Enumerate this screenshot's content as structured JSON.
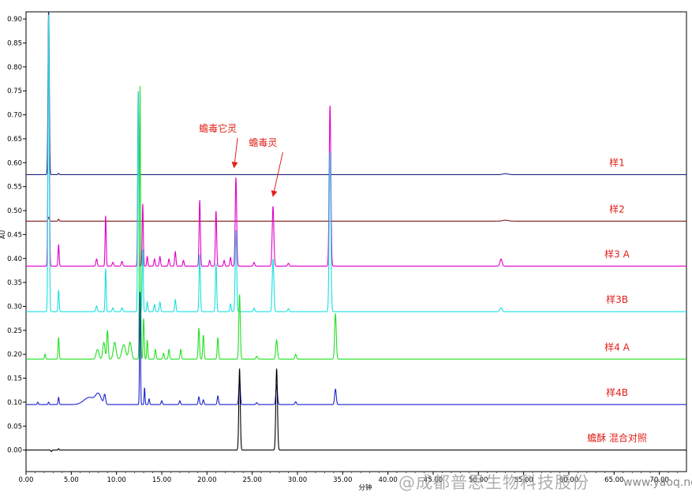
{
  "chart_data": {
    "type": "line",
    "title": "",
    "xlabel": "分钟",
    "ylabel": "AU",
    "xlim": [
      0,
      73
    ],
    "ylim": [
      -0.045,
      0.915
    ],
    "x_ticks": [
      "0.00",
      "5.00",
      "10.00",
      "15.00",
      "20.00",
      "25.00",
      "30.00",
      "35.00",
      "40.00",
      "45.00",
      "50.00",
      "55.00",
      "60.00",
      "65.00",
      "70.00"
    ],
    "x_tick_values": [
      0,
      5,
      10,
      15,
      20,
      25,
      30,
      35,
      40,
      45,
      50,
      55,
      60,
      65,
      70
    ],
    "y_ticks": [
      "0.00",
      "0.05",
      "0.10",
      "0.15",
      "0.20",
      "0.25",
      "0.30",
      "0.35",
      "0.40",
      "0.45",
      "0.50",
      "0.55",
      "0.60",
      "0.65",
      "0.70",
      "0.75",
      "0.80",
      "0.85",
      "0.90"
    ],
    "y_tick_values": [
      0,
      0.05,
      0.1,
      0.15,
      0.2,
      0.25,
      0.3,
      0.35,
      0.4,
      0.45,
      0.5,
      0.55,
      0.6,
      0.65,
      0.7,
      0.75,
      0.8,
      0.85,
      0.9
    ],
    "grid": false,
    "series": [
      {
        "name": "样1",
        "color": "#1a237e",
        "baseline": 0.575,
        "peaks": [
          [
            2.5,
            0.35,
            0.07
          ],
          [
            3.6,
            0.003,
            0.06
          ],
          [
            53,
            0.002,
            0.3
          ]
        ]
      },
      {
        "name": "样2",
        "color": "#7b1a1a",
        "baseline": 0.478,
        "peaks": [
          [
            2.5,
            0.008,
            0.07
          ],
          [
            3.6,
            0.004,
            0.06
          ],
          [
            53,
            0.002,
            0.3
          ]
        ]
      },
      {
        "name": "样3 A",
        "color": "#e000c8",
        "baseline": 0.384,
        "peaks": [
          [
            2.5,
            0.525,
            0.07
          ],
          [
            3.6,
            0.045,
            0.06
          ],
          [
            7.8,
            0.015,
            0.08
          ],
          [
            8.8,
            0.105,
            0.06
          ],
          [
            9.6,
            0.008,
            0.08
          ],
          [
            10.6,
            0.01,
            0.08
          ],
          [
            12.4,
            0.365,
            0.06
          ],
          [
            12.9,
            0.13,
            0.06
          ],
          [
            13.4,
            0.02,
            0.06
          ],
          [
            14.2,
            0.015,
            0.07
          ],
          [
            14.8,
            0.02,
            0.07
          ],
          [
            15.8,
            0.015,
            0.07
          ],
          [
            16.5,
            0.03,
            0.07
          ],
          [
            17.4,
            0.012,
            0.07
          ],
          [
            19.2,
            0.138,
            0.07
          ],
          [
            20.3,
            0.012,
            0.07
          ],
          [
            21.0,
            0.115,
            0.07
          ],
          [
            21.9,
            0.012,
            0.07
          ],
          [
            22.6,
            0.018,
            0.07
          ],
          [
            23.2,
            0.185,
            0.08
          ],
          [
            25.2,
            0.008,
            0.08
          ],
          [
            27.3,
            0.125,
            0.09
          ],
          [
            29.0,
            0.006,
            0.08
          ],
          [
            33.6,
            0.335,
            0.09
          ],
          [
            52.5,
            0.015,
            0.12
          ]
        ]
      },
      {
        "name": "样3B",
        "color": "#19e0e0",
        "baseline": 0.289,
        "peaks": [
          [
            2.5,
            0.62,
            0.07
          ],
          [
            3.6,
            0.045,
            0.06
          ],
          [
            7.8,
            0.012,
            0.08
          ],
          [
            8.8,
            0.09,
            0.06
          ],
          [
            9.6,
            0.008,
            0.08
          ],
          [
            10.6,
            0.008,
            0.08
          ],
          [
            12.4,
            0.46,
            0.06
          ],
          [
            12.9,
            0.13,
            0.06
          ],
          [
            13.4,
            0.02,
            0.06
          ],
          [
            14.2,
            0.015,
            0.07
          ],
          [
            14.8,
            0.02,
            0.07
          ],
          [
            16.5,
            0.025,
            0.07
          ],
          [
            19.2,
            0.12,
            0.07
          ],
          [
            21.0,
            0.1,
            0.07
          ],
          [
            22.6,
            0.016,
            0.07
          ],
          [
            23.2,
            0.17,
            0.08
          ],
          [
            25.2,
            0.007,
            0.08
          ],
          [
            27.3,
            0.11,
            0.09
          ],
          [
            29.0,
            0.006,
            0.08
          ],
          [
            33.6,
            0.335,
            0.09
          ],
          [
            52.5,
            0.008,
            0.12
          ]
        ]
      },
      {
        "name": "样4 A",
        "color": "#22e022",
        "baseline": 0.19,
        "peaks": [
          [
            2.1,
            0.01,
            0.06
          ],
          [
            3.6,
            0.045,
            0.06
          ],
          [
            7.9,
            0.02,
            0.15
          ],
          [
            8.6,
            0.035,
            0.12
          ],
          [
            9.0,
            0.06,
            0.08
          ],
          [
            9.8,
            0.035,
            0.15
          ],
          [
            10.8,
            0.03,
            0.2
          ],
          [
            11.5,
            0.035,
            0.15
          ],
          [
            12.6,
            0.57,
            0.06
          ],
          [
            13.0,
            0.085,
            0.06
          ],
          [
            13.4,
            0.04,
            0.06
          ],
          [
            14.3,
            0.02,
            0.07
          ],
          [
            15.2,
            0.012,
            0.07
          ],
          [
            15.8,
            0.02,
            0.07
          ],
          [
            17.1,
            0.02,
            0.07
          ],
          [
            19.1,
            0.065,
            0.07
          ],
          [
            19.6,
            0.05,
            0.07
          ],
          [
            21.2,
            0.045,
            0.07
          ],
          [
            23.6,
            0.135,
            0.08
          ],
          [
            25.5,
            0.006,
            0.08
          ],
          [
            27.7,
            0.04,
            0.09
          ],
          [
            29.8,
            0.01,
            0.08
          ],
          [
            34.2,
            0.095,
            0.09
          ]
        ]
      },
      {
        "name": "样4B",
        "color": "#1a22cc",
        "baseline": 0.095,
        "peaks": [
          [
            1.3,
            0.005,
            0.06
          ],
          [
            2.5,
            0.005,
            0.06
          ],
          [
            3.6,
            0.015,
            0.06
          ],
          [
            7.0,
            0.015,
            0.6
          ],
          [
            8.0,
            0.02,
            0.3
          ],
          [
            8.7,
            0.02,
            0.1
          ],
          [
            12.6,
            0.235,
            0.05
          ],
          [
            13.1,
            0.035,
            0.05
          ],
          [
            13.6,
            0.012,
            0.06
          ],
          [
            15.0,
            0.008,
            0.07
          ],
          [
            17.0,
            0.008,
            0.07
          ],
          [
            19.1,
            0.016,
            0.07
          ],
          [
            19.6,
            0.01,
            0.07
          ],
          [
            21.2,
            0.018,
            0.07
          ],
          [
            23.6,
            0.055,
            0.08
          ],
          [
            25.5,
            0.004,
            0.08
          ],
          [
            27.7,
            0.04,
            0.09
          ],
          [
            29.8,
            0.006,
            0.08
          ],
          [
            34.2,
            0.032,
            0.09
          ]
        ]
      },
      {
        "name": "蟾酥 混合对照",
        "color": "#000000",
        "baseline": 0.0,
        "peaks": [
          [
            2.8,
            -0.003,
            0.06
          ],
          [
            3.6,
            0.003,
            0.05
          ],
          [
            23.6,
            0.17,
            0.08
          ],
          [
            27.7,
            0.17,
            0.09
          ]
        ]
      }
    ],
    "annotations": [
      {
        "text": "蟾毒它灵",
        "color": "#e0201a",
        "x": 21.2,
        "y": 0.665,
        "arrow_to": [
          23.0,
          0.59
        ]
      },
      {
        "text": "蟾毒灵",
        "color": "#e0201a",
        "x": 26.2,
        "y": 0.635,
        "arrow_to": [
          27.3,
          0.53
        ]
      }
    ],
    "legend": "right, next to each trace"
  },
  "watermark": {
    "text": "@成都普思生物科技股份",
    "site": "www.yaoq.net"
  }
}
